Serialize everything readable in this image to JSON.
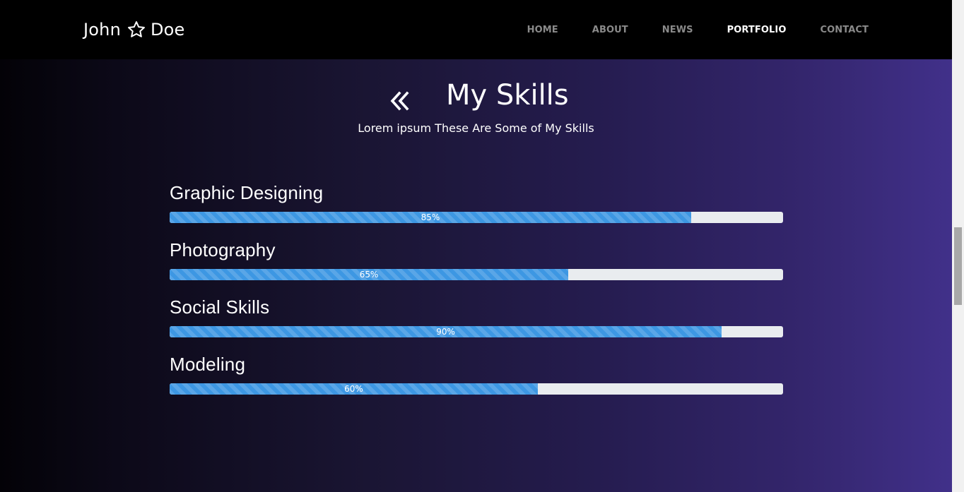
{
  "brand": {
    "first": "John",
    "last": "Doe",
    "icon": "star-outline-icon"
  },
  "nav": {
    "items": [
      {
        "label": "HOME",
        "active": false
      },
      {
        "label": "ABOUT",
        "active": false
      },
      {
        "label": "NEWS",
        "active": false
      },
      {
        "label": "PORTFOLIO",
        "active": true
      },
      {
        "label": "CONTACT",
        "active": false
      }
    ]
  },
  "section": {
    "title": "My Skills",
    "subtitle": "Lorem ipsum These Are Some of My Skills",
    "back_icon": "double-chevron-left-icon"
  },
  "skills": [
    {
      "name": "Graphic Designing",
      "percent": 85,
      "label": "85%"
    },
    {
      "name": "Photography",
      "percent": 65,
      "label": "65%"
    },
    {
      "name": "Social Skills",
      "percent": 90,
      "label": "90%"
    },
    {
      "name": "Modeling",
      "percent": 60,
      "label": "60%"
    }
  ],
  "colors": {
    "bar_fill": "#3d97e3",
    "bar_track": "#e9ecef",
    "nav_background": "#000000",
    "nav_inactive": "#8a8a8a",
    "nav_active": "#ffffff",
    "gradient_end": "#42318c"
  }
}
